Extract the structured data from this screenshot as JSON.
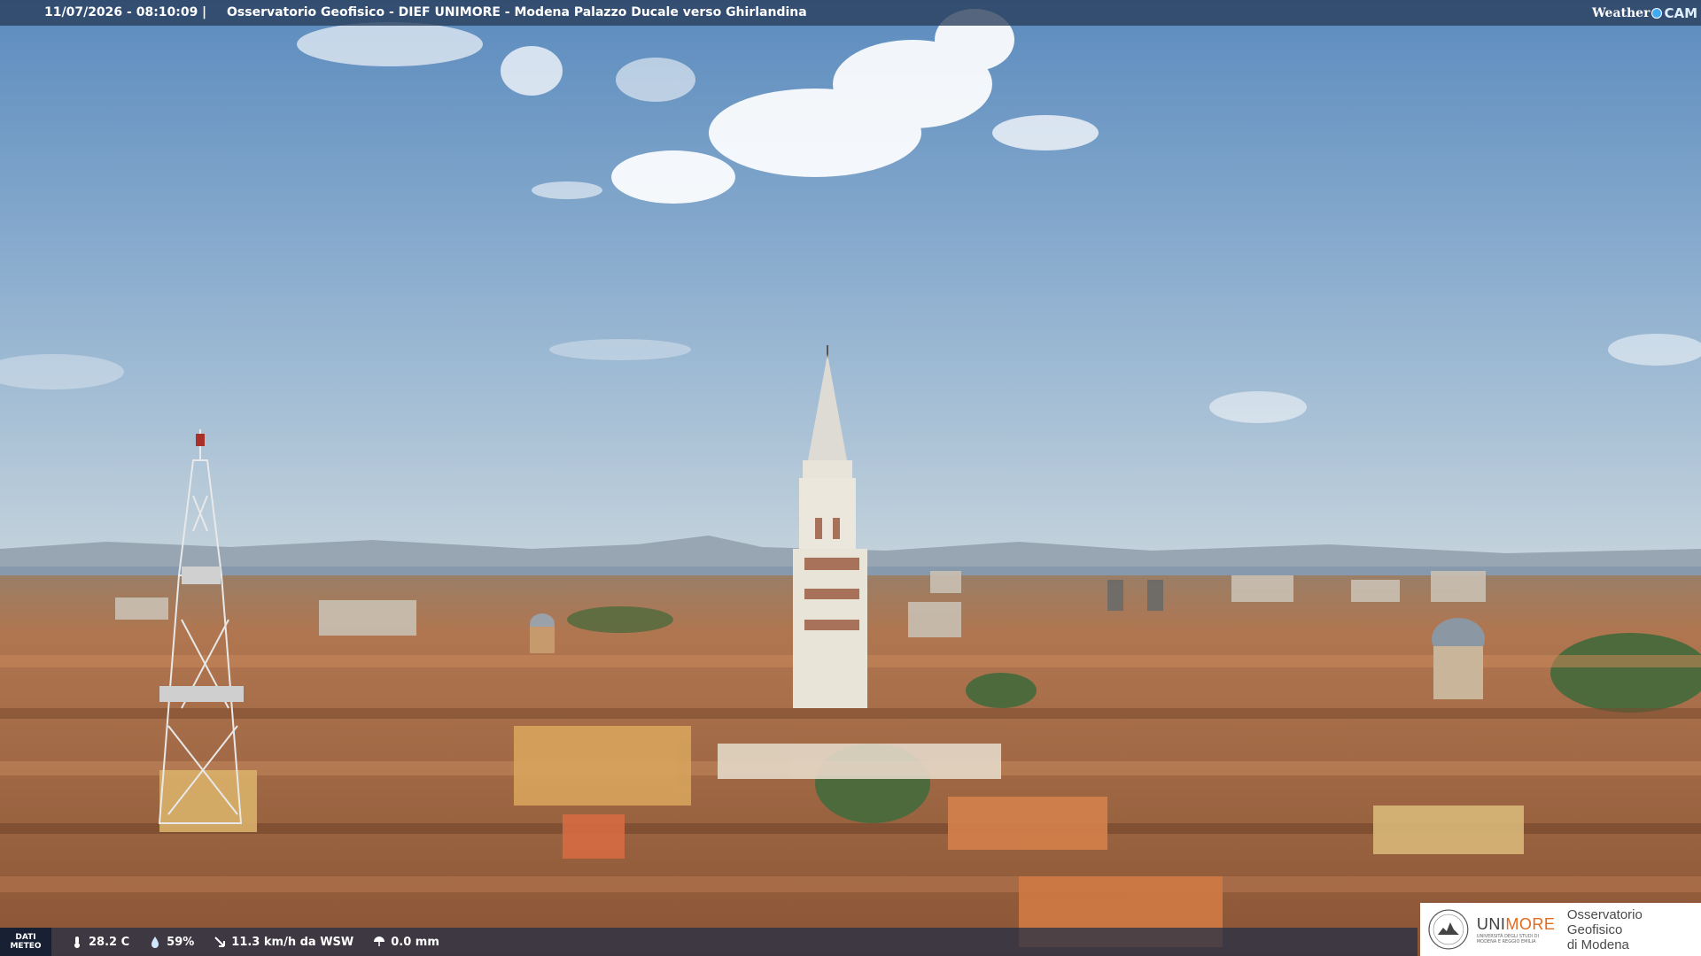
{
  "overlay": {
    "timestamp": "11/07/2026 - 08:10:09",
    "separator": "|",
    "location": "Osservatorio Geofisico - DIEF UNIMORE - Modena Palazzo Ducale verso Ghirlandina",
    "brand_weather": "Weather",
    "brand_cam": "CAM"
  },
  "weather": {
    "badge_line1": "DATI",
    "badge_line2": "METEO",
    "temperature": "28.2 C",
    "humidity": "59%",
    "wind": "11.3 km/h da WSW",
    "rain": "0.0 mm"
  },
  "logo": {
    "name_prefix": "UNI",
    "name_suffix": "MORE",
    "sub": "UNIVERSITÀ DEGLI STUDI DI MODENA E REGGIO EMILIA",
    "line1": "Osservatorio Geofisico",
    "line2": "di Modena"
  },
  "colors": {
    "sky_top": "#5d8cbd",
    "sky_bottom": "#b8cede",
    "roofs": "#a86b45",
    "tower": "#e8e4da",
    "accent": "#e26a1c"
  }
}
